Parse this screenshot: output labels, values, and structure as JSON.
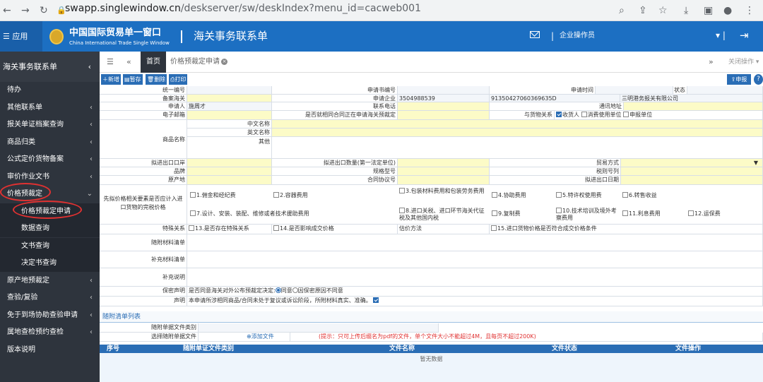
{
  "browser": {
    "url_host": "swapp.singlewindow.cn",
    "url_path": "/deskserver/sw/deskIndex?menu_id=cacweb001"
  },
  "header": {
    "app_label": "应用",
    "logo_cn": "中国国际贸易单一窗口",
    "logo_en": "China International Trade Single Window",
    "system_title": "海关事务联系单",
    "user_label": "企业操作员",
    "brand_color": "#1c6fc2"
  },
  "sidebar": {
    "top_label": "海关事务联系单",
    "items": [
      {
        "label": "待办",
        "chev": ""
      },
      {
        "label": "其他联系单",
        "chev": "‹"
      },
      {
        "label": "报关单证档案查询",
        "chev": "‹"
      },
      {
        "label": "商品归类",
        "chev": "‹"
      },
      {
        "label": "公式定价货物备案",
        "chev": "‹"
      },
      {
        "label": "审价作业文书",
        "chev": "‹"
      },
      {
        "label": "价格预裁定",
        "chev": "⌄"
      }
    ],
    "subitems": [
      "价格预裁定申请",
      "数据查询",
      "文书查询",
      "决定书查询"
    ],
    "items2": [
      {
        "label": "原产地预裁定",
        "chev": "‹"
      },
      {
        "label": "查验/复验",
        "chev": "‹"
      },
      {
        "label": "免于到场协助查验申请",
        "chev": "‹"
      },
      {
        "label": "属地查检预约查检",
        "chev": "‹"
      },
      {
        "label": "版本说明",
        "chev": ""
      }
    ]
  },
  "tabs": {
    "home": "首页",
    "active": "价格预裁定申请",
    "close_ops": "关闭操作"
  },
  "toolbar": {
    "add": "新增",
    "save": "暂存",
    "delete": "删除",
    "print": "打印",
    "declare": "申报"
  },
  "form": {
    "unified_no": "统一编号",
    "apply_no": "申请书编号",
    "apply_time": "申请时间",
    "status": "状态",
    "customs": "备案海关",
    "apply_company": "申请企业",
    "company_code": "3504988539",
    "credit_code": "91350427060369635D",
    "company_name": "三明港务报关有限公司",
    "applicant": "申请人",
    "applicant_name": "施周才",
    "contact_phone": "联系电话",
    "address": "通讯地址",
    "email": "电子邮箱",
    "same_contract": "是否就相同合同正在申请海关预裁定",
    "goods_relation": "与货物关系",
    "rel_consignee": "收货人",
    "rel_user": "消费使用单位",
    "rel_declarant": "申报单位",
    "goods_name": "商品名称",
    "name_cn": "中文名称",
    "name_en": "英文名称",
    "name_other": "其他",
    "port": "拟进出口口岸",
    "qty": "拟进出口数量(第一法定单位)",
    "trade_mode": "贸易方式",
    "brand": "品牌",
    "spec": "规格型号",
    "hs_code": "税则号列",
    "origin": "原产地",
    "contract_no": "合同协议号",
    "date": "拟进出口日期",
    "price_q": "先拟价格相关要素是否应计入进口货物的完税价格",
    "opts": [
      "1.佣金和经纪费",
      "2.容器费用",
      "3.包装材料费用和包装劳务费用",
      "4.协助费用",
      "5.特许权使用费",
      "6.转售收益",
      "7.设计、安装、装配、维修或者技术援助费用",
      "8.进口关税、进口环节海关代征税及其他国内税",
      "9.复制费",
      "10.技术培训及境外考察费用",
      "11.利息费用",
      "12.运保费"
    ],
    "special": "特殊关系",
    "opt13": "13.是否存在特殊关系",
    "opt14": "14.是否影响成交价格",
    "valuation": "估价方法",
    "opt15": "15.进口货物价格是否符合成交价格条件",
    "attach_list": "随附材料清单",
    "supp_list": "补充材料清单",
    "supp_note": "补充说明",
    "secret": "保密声明",
    "secret_q": "是否同意海关对外公布预裁定决定:",
    "agree": "同意",
    "disagree": "因保密原因不同意",
    "declare": "声明",
    "declare_text": "本申请所涉相同商品/合同未处于复议或诉讼阶段，所附材料真实、准确。"
  },
  "attach": {
    "title": "随附清单列表",
    "type_label": "随附单据文件类别",
    "file_label": "选择随附单据文件",
    "add_file": "添加文件",
    "tip": "(提示：只可上传后缀名为pdf的文件，单个文件大小不能超过4M，且每页不超过200K)",
    "columns": [
      "序号",
      "随附单证文件类别",
      "文件名称",
      "文件状态",
      "文件操作"
    ],
    "no_data": "暂无数据"
  }
}
